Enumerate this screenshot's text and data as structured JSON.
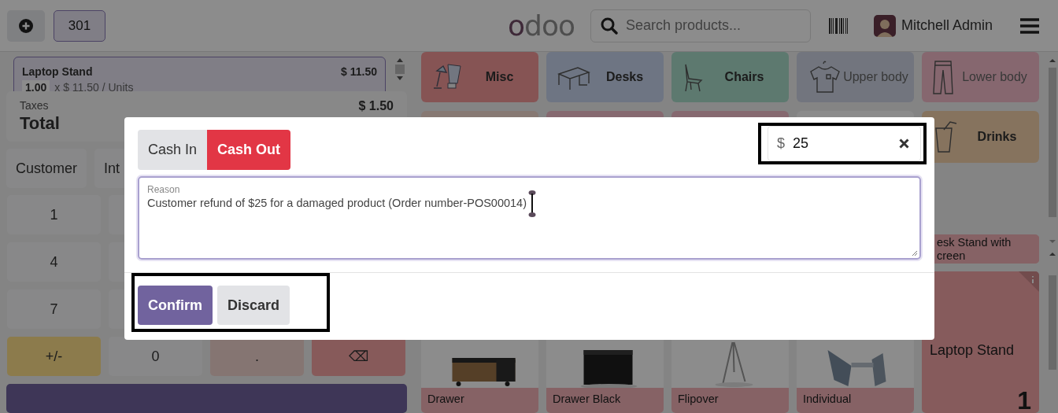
{
  "header": {
    "order_tabs": [
      {
        "label": "301",
        "selected": true
      }
    ],
    "logo": "odoo",
    "search": {
      "placeholder": "Search products..."
    },
    "user": {
      "name": "Mitchell Admin"
    }
  },
  "order": {
    "lines": [
      {
        "name": "Laptop Stand",
        "price": "$ 11.50",
        "quantity": "1.00",
        "unit_price": "x $ 11.50 / Units",
        "selected": true
      }
    ],
    "taxes_label": "Taxes",
    "taxes": "$ 1.50",
    "total_label": "Total"
  },
  "actions": [
    {
      "label": "Customer"
    },
    {
      "label": "Int"
    }
  ],
  "numpad": [
    [
      {
        "kind": "digit",
        "label": "1"
      },
      {
        "kind": "digit"
      }
    ],
    [
      {
        "kind": "digit",
        "label": "4"
      },
      {
        "kind": "digit"
      }
    ],
    [
      {
        "kind": "digit",
        "label": "7"
      },
      {
        "kind": "digit"
      }
    ],
    [
      {
        "kind": "sign",
        "label": "+/-"
      },
      {
        "kind": "digit",
        "label": "0"
      },
      {
        "kind": "decimal",
        "label": "."
      },
      {
        "kind": "backspace",
        "label": "⌫"
      }
    ]
  ],
  "categories": [
    {
      "label": "Misc"
    },
    {
      "label": "Desks"
    },
    {
      "label": "Chairs"
    },
    {
      "label": "Upper body"
    },
    {
      "label": "Lower body"
    },
    {
      "label": "Drinks"
    }
  ],
  "product_rows": [
    [
      {
        "name_lines": [
          "esk Stand with",
          "creen"
        ],
        "selected": false
      }
    ],
    [
      {
        "name_lines": [
          "Drawer"
        ],
        "selected": false
      },
      {
        "name_lines": [
          "Drawer Black"
        ],
        "selected": false
      },
      {
        "name_lines": [
          "Flipover"
        ],
        "selected": false
      },
      {
        "name_lines": [
          "Individual"
        ],
        "selected": false
      },
      {
        "name_lines": [
          "Laptop Stand"
        ],
        "selected": true,
        "quantity": "1"
      }
    ]
  ],
  "dialog": {
    "cash_types": [
      {
        "label": "Cash In",
        "selected": false
      },
      {
        "label": "Cash Out",
        "selected": true
      }
    ],
    "amount": {
      "currency": "$",
      "value": "25",
      "highlighted": true
    },
    "reason": {
      "label": "Reason",
      "value": "Customer refund of $25 for a damaged product (Order number-POS00014)",
      "focused": true
    },
    "buttons": [
      {
        "label": "Confirm",
        "kind": "primary"
      },
      {
        "label": "Discard",
        "kind": "secondary"
      }
    ],
    "buttons_highlighted": true
  }
}
